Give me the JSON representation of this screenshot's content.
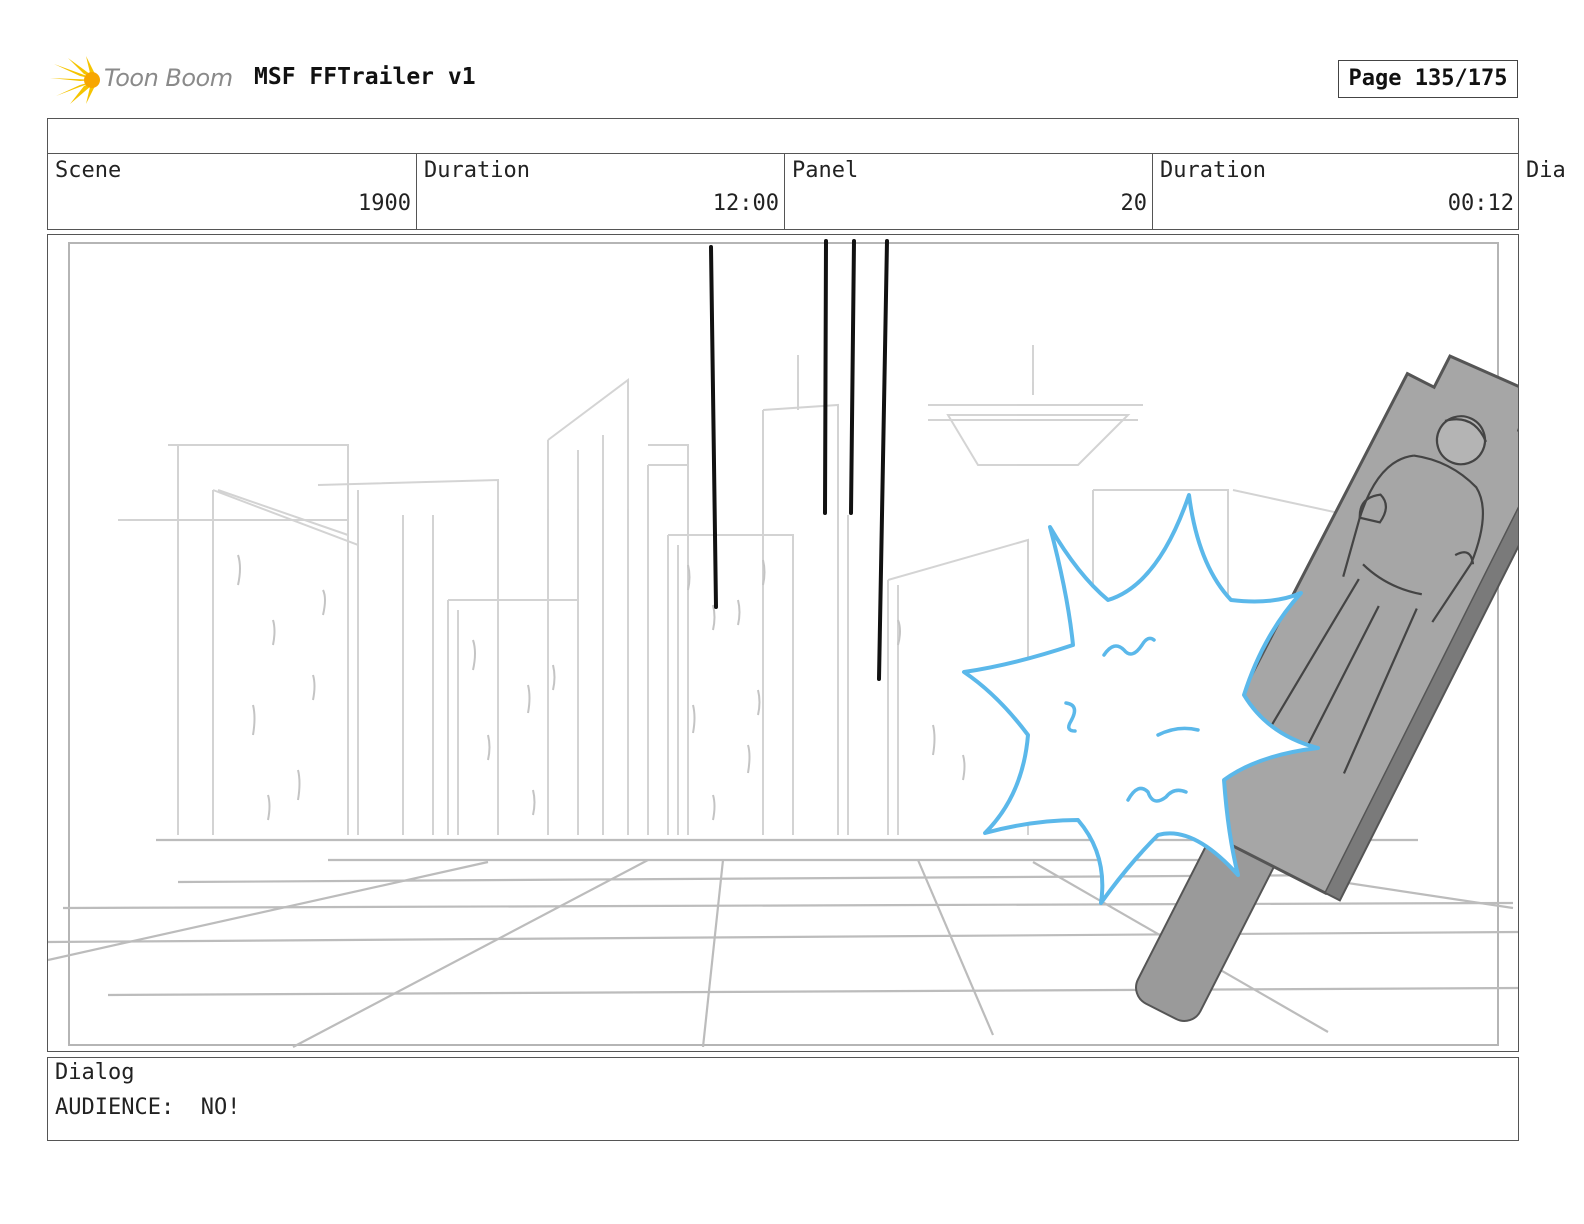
{
  "header": {
    "logo_text": "Toon Boom",
    "document_title": "MSF FFTrailer v1",
    "page_label": "Page 135/175"
  },
  "info": {
    "scene_label": "Scene",
    "scene_value": "1900",
    "scene_duration_label": "Duration",
    "scene_duration_value": "12:00",
    "panel_label": "Panel",
    "panel_value": "20",
    "panel_duration_label": "Duration",
    "panel_duration_value": "00:12",
    "overflow_label": "Dia"
  },
  "dialog": {
    "label": "Dialog",
    "text": "AUDIENCE:  NO!"
  },
  "colors": {
    "sketch_gray": "#c8c8c8",
    "impact_blue": "#5bb8ea",
    "target_gray": "#a8a8a8",
    "logo_yellow": "#f5c400"
  }
}
